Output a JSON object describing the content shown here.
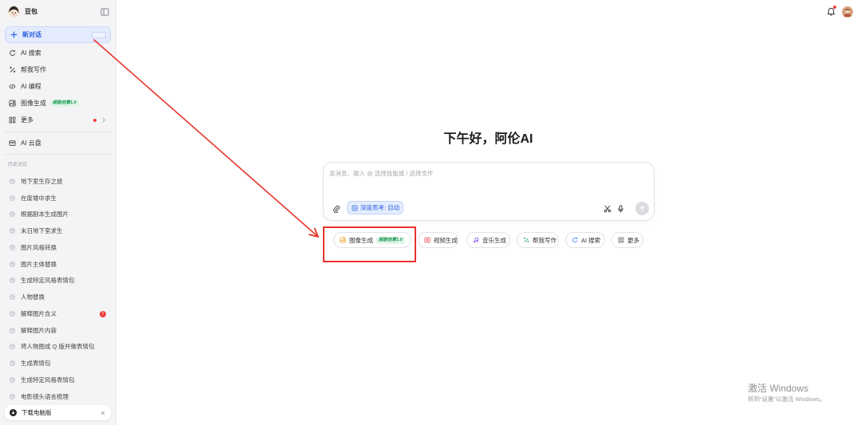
{
  "sidebar": {
    "app_name": "豆包",
    "new_chat_label": "新对话",
    "nav": [
      {
        "icon": "search-icon",
        "label": "AI 搜索"
      },
      {
        "icon": "pen-icon",
        "label": "帮我写作"
      },
      {
        "icon": "code-icon",
        "label": "AI 编程"
      },
      {
        "icon": "image-icon",
        "label": "图像生成",
        "badge": "超能创意1.0"
      },
      {
        "icon": "grid-icon",
        "label": "更多",
        "has_new_dot": true,
        "has_chevron": true
      }
    ],
    "cloud": {
      "icon": "cloud-icon",
      "label": "AI 云盘"
    },
    "history_title": "历史对话",
    "history": [
      {
        "label": "地下室生存之旅"
      },
      {
        "label": "在废墟中求生"
      },
      {
        "label": "根据剧本生成图片"
      },
      {
        "label": "末日地下室求生"
      },
      {
        "label": "图片风格转换"
      },
      {
        "label": "图片主体替换"
      },
      {
        "label": "生成特定风格表情包"
      },
      {
        "label": "人物替换"
      },
      {
        "label": "解释图片含义",
        "badge": "!"
      },
      {
        "label": "解释图片内容"
      },
      {
        "label": "将人物图成 Q 版并做表情包"
      },
      {
        "label": "生成表情包"
      },
      {
        "label": "生成特定风格表情包"
      },
      {
        "label": "电影镜头语言梳理"
      }
    ],
    "download_label": "下载电脑版"
  },
  "main": {
    "greeting": "下午好，阿伦AI",
    "input": {
      "placeholder": "发消息、输入 @ 选择技能或 / 选择文件"
    },
    "deep_think_label": "深度思考: 自动",
    "chips": [
      {
        "icon": "image-icon",
        "label": "图像生成",
        "badge": "超能创意1.0",
        "color": "#f0a02e"
      },
      {
        "icon": "video-icon",
        "label": "视频生成",
        "color": "#e5484d"
      },
      {
        "icon": "music-icon",
        "label": "音乐生成",
        "color": "#8b5cf6"
      },
      {
        "icon": "pen-icon",
        "label": "帮我写作",
        "color": "#22a55b"
      },
      {
        "icon": "search-icon",
        "label": "AI 搜索",
        "color": "#3b82f6"
      },
      {
        "icon": "grid-icon",
        "label": "更多",
        "color": "#666666"
      }
    ]
  },
  "watermark": {
    "title": "激活 Windows",
    "subtitle": "转到“设置”以激活 Windows。"
  },
  "colors": {
    "accent": "#2d62e4",
    "annotation": "#e8342b",
    "sidebar_bg": "#f4f4f6",
    "badge_green": "#1d9b55"
  }
}
